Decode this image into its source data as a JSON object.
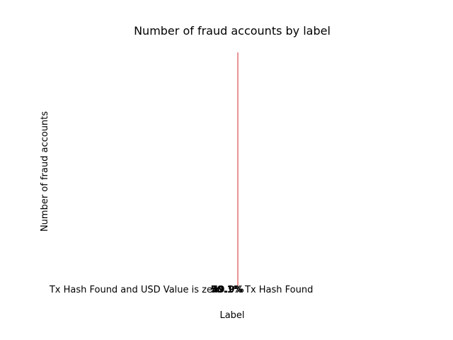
{
  "chart_data": {
    "type": "bar",
    "title": "Number of fraud accounts by label",
    "xlabel": "Label",
    "ylabel": "Number of fraud accounts",
    "categories": [
      "Tx Hash Found and USD Value is zero",
      "Tx Hash Found"
    ],
    "data_labels": [
      "50.1%",
      "49.9%"
    ],
    "colors": {
      "accent": "#d62728",
      "text": "#000000"
    },
    "grid": false,
    "legend": "none"
  }
}
